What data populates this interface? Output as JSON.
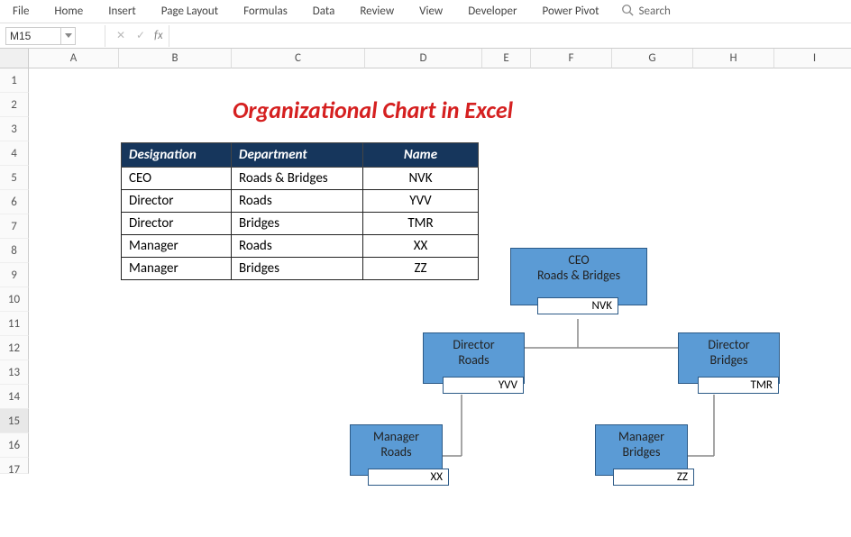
{
  "ribbon": {
    "tabs": [
      "File",
      "Home",
      "Insert",
      "Page Layout",
      "Formulas",
      "Data",
      "Review",
      "View",
      "Developer",
      "Power Pivot"
    ],
    "search_placeholder": "Search"
  },
  "formula_bar": {
    "cell_ref": "M15",
    "fx_label": "fx"
  },
  "columns": [
    "A",
    "B",
    "C",
    "D",
    "E",
    "F",
    "G",
    "H",
    "I"
  ],
  "rows": [
    "1",
    "2",
    "3",
    "4",
    "5",
    "6",
    "7",
    "8",
    "9",
    "10",
    "11",
    "12",
    "13",
    "14",
    "15",
    "16",
    "17"
  ],
  "selected_row": "15",
  "title": "Organizational Chart in Excel",
  "table": {
    "headers": [
      "Designation",
      "Department",
      "Name"
    ],
    "rows": [
      [
        "CEO",
        "Roads & Bridges",
        "NVK"
      ],
      [
        "Director",
        "Roads",
        "YVV"
      ],
      [
        "Director",
        "Bridges",
        "TMR"
      ],
      [
        "Manager",
        "Roads",
        "XX"
      ],
      [
        "Manager",
        "Bridges",
        "ZZ"
      ]
    ]
  },
  "chart_data": {
    "type": "org-chart",
    "title": "Organizational Chart in Excel",
    "nodes": [
      {
        "id": "n0",
        "designation": "CEO",
        "department": "Roads & Bridges",
        "name": "NVK",
        "parent": null
      },
      {
        "id": "n1",
        "designation": "Director",
        "department": "Roads",
        "name": "YVV",
        "parent": "n0"
      },
      {
        "id": "n2",
        "designation": "Director",
        "department": "Bridges",
        "name": "TMR",
        "parent": "n0"
      },
      {
        "id": "n3",
        "designation": "Manager",
        "department": "Roads",
        "name": "XX",
        "parent": "n1"
      },
      {
        "id": "n4",
        "designation": "Manager",
        "department": "Bridges",
        "name": "ZZ",
        "parent": "n2"
      }
    ]
  }
}
